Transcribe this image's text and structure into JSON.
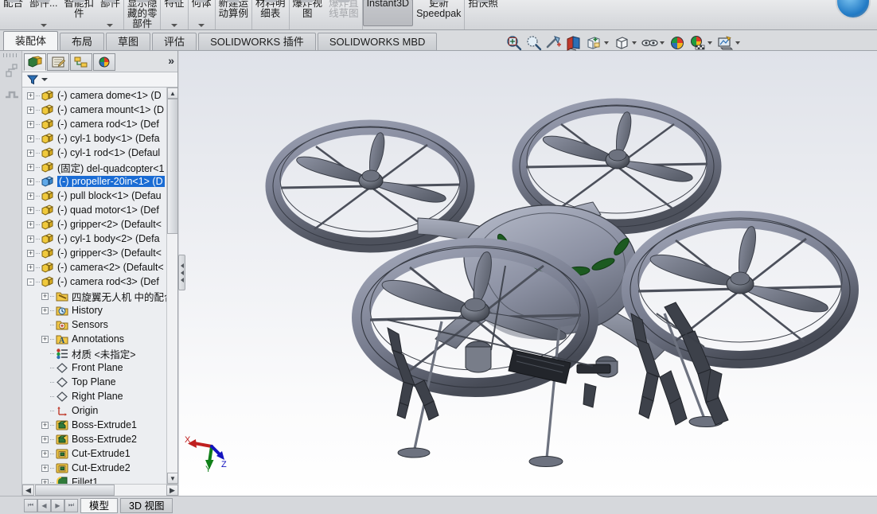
{
  "ribbon": {
    "buttons": [
      {
        "label": "配合",
        "carat": false,
        "dim": false,
        "pressed": false,
        "sep": false
      },
      {
        "label": "部件...",
        "carat": true,
        "dim": false,
        "pressed": false,
        "sep": false
      },
      {
        "label": "智能扣\n件",
        "carat": false,
        "dim": false,
        "pressed": false,
        "sep": false
      },
      {
        "label": "部件",
        "carat": true,
        "dim": false,
        "pressed": false,
        "sep": true
      },
      {
        "label": "显示隐\n藏的零\n部件",
        "carat": false,
        "dim": false,
        "pressed": false,
        "sep": true
      },
      {
        "label": "特征",
        "carat": true,
        "dim": false,
        "pressed": false,
        "sep": true
      },
      {
        "label": "何体",
        "carat": true,
        "dim": false,
        "pressed": false,
        "sep": true
      },
      {
        "label": "新建运\n动算例",
        "carat": false,
        "dim": false,
        "pressed": false,
        "sep": true
      },
      {
        "label": "材料明\n细表",
        "carat": false,
        "dim": false,
        "pressed": false,
        "sep": true
      },
      {
        "label": "爆炸视\n图",
        "carat": false,
        "dim": false,
        "pressed": false,
        "sep": false
      },
      {
        "label": "爆炸直\n线草图",
        "carat": false,
        "dim": true,
        "pressed": false,
        "sep": true
      },
      {
        "label": "Instant3D",
        "carat": false,
        "dim": false,
        "pressed": true,
        "sep": false
      },
      {
        "label": "更新\nSpeedpak",
        "carat": false,
        "dim": false,
        "pressed": false,
        "sep": true
      },
      {
        "label": "拍快照",
        "carat": false,
        "dim": false,
        "pressed": false,
        "sep": false
      }
    ]
  },
  "command_tabs": [
    {
      "label": "装配体",
      "active": true
    },
    {
      "label": "布局",
      "active": false
    },
    {
      "label": "草图",
      "active": false
    },
    {
      "label": "评估",
      "active": false
    },
    {
      "label": "SOLIDWORKS 插件",
      "active": false
    },
    {
      "label": "SOLIDWORKS MBD",
      "active": false
    }
  ],
  "view_toolbar": [
    {
      "icon": "zoom-to-fit-icon",
      "dropdown": false
    },
    {
      "icon": "zoom-to-area-icon",
      "dropdown": false
    },
    {
      "icon": "previous-view-icon",
      "dropdown": false
    },
    {
      "icon": "section-view-icon",
      "dropdown": false
    },
    {
      "icon": "view-orientation-icon",
      "dropdown": true
    },
    {
      "icon": "display-style-icon",
      "dropdown": true
    },
    {
      "icon": "hide-show-items-icon",
      "dropdown": true
    },
    {
      "icon": "edit-appearance-icon",
      "dropdown": false
    },
    {
      "icon": "apply-scene-icon",
      "dropdown": true
    },
    {
      "icon": "view-settings-icon",
      "dropdown": true
    }
  ],
  "feature_manager": {
    "tabs": [
      {
        "name": "featuremanager-design-tree-tab",
        "active": true
      },
      {
        "name": "property-manager-tab",
        "active": false
      },
      {
        "name": "configuration-manager-tab",
        "active": false
      },
      {
        "name": "display-manager-tab",
        "active": false
      }
    ],
    "expand_label": "»",
    "filter_placeholder": "",
    "tree": [
      {
        "label": "(-) camera dome<1> (D",
        "icon": "part-icon",
        "expander": "+",
        "indent": 0,
        "selected": false
      },
      {
        "label": "(-) camera mount<1> (D",
        "icon": "part-icon",
        "expander": "+",
        "indent": 0,
        "selected": false
      },
      {
        "label": "(-) camera rod<1> (Def",
        "icon": "part-icon",
        "expander": "+",
        "indent": 0,
        "selected": false
      },
      {
        "label": "(-) cyl-1 body<1> (Defa",
        "icon": "part-icon",
        "expander": "+",
        "indent": 0,
        "selected": false
      },
      {
        "label": "(-) cyl-1 rod<1> (Defaul",
        "icon": "part-icon",
        "expander": "+",
        "indent": 0,
        "selected": false
      },
      {
        "label": "(固定) del-quadcopter<1",
        "icon": "part-icon",
        "expander": "+",
        "indent": 0,
        "selected": false
      },
      {
        "label": "(-) propeller-20in<1> (D",
        "icon": "part-icon-blue",
        "expander": "+",
        "indent": 0,
        "selected": true
      },
      {
        "label": "(-) pull block<1> (Defau",
        "icon": "part-icon",
        "expander": "+",
        "indent": 0,
        "selected": false
      },
      {
        "label": "(-) quad motor<1> (Def",
        "icon": "part-icon",
        "expander": "+",
        "indent": 0,
        "selected": false
      },
      {
        "label": "(-) gripper<2> (Default<",
        "icon": "part-icon",
        "expander": "+",
        "indent": 0,
        "selected": false
      },
      {
        "label": "(-) cyl-1 body<2> (Defa",
        "icon": "part-icon",
        "expander": "+",
        "indent": 0,
        "selected": false
      },
      {
        "label": "(-) gripper<3> (Default<",
        "icon": "part-icon",
        "expander": "+",
        "indent": 0,
        "selected": false
      },
      {
        "label": "(-) camera<2> (Default<",
        "icon": "part-icon",
        "expander": "+",
        "indent": 0,
        "selected": false
      },
      {
        "label": "(-) camera rod<3> (Def",
        "icon": "part-icon",
        "expander": "-",
        "indent": 0,
        "selected": false
      },
      {
        "label": "四旋翼无人机 中的配合",
        "icon": "mates-folder-icon",
        "expander": "+",
        "indent": 1,
        "selected": false
      },
      {
        "label": "History",
        "icon": "history-icon",
        "expander": "+",
        "indent": 1,
        "selected": false
      },
      {
        "label": "Sensors",
        "icon": "sensors-icon",
        "expander": "",
        "indent": 1,
        "selected": false
      },
      {
        "label": "Annotations",
        "icon": "annotations-icon",
        "expander": "+",
        "indent": 1,
        "selected": false
      },
      {
        "label": "材质 <未指定>",
        "icon": "material-icon",
        "expander": "",
        "indent": 1,
        "selected": false
      },
      {
        "label": "Front Plane",
        "icon": "plane-icon",
        "expander": "",
        "indent": 1,
        "selected": false
      },
      {
        "label": "Top Plane",
        "icon": "plane-icon",
        "expander": "",
        "indent": 1,
        "selected": false
      },
      {
        "label": "Right Plane",
        "icon": "plane-icon",
        "expander": "",
        "indent": 1,
        "selected": false
      },
      {
        "label": "Origin",
        "icon": "origin-icon",
        "expander": "",
        "indent": 1,
        "selected": false
      },
      {
        "label": "Boss-Extrude1",
        "icon": "boss-extrude-icon",
        "expander": "+",
        "indent": 1,
        "selected": false
      },
      {
        "label": "Boss-Extrude2",
        "icon": "boss-extrude-icon",
        "expander": "+",
        "indent": 1,
        "selected": false
      },
      {
        "label": "Cut-Extrude1",
        "icon": "cut-extrude-icon",
        "expander": "+",
        "indent": 1,
        "selected": false
      },
      {
        "label": "Cut-Extrude2",
        "icon": "cut-extrude-icon",
        "expander": "+",
        "indent": 1,
        "selected": false
      },
      {
        "label": "Fillet1",
        "icon": "fillet-icon",
        "expander": "+",
        "indent": 1,
        "selected": false
      }
    ]
  },
  "bottom_bar": {
    "nav": [
      "first-record-icon",
      "previous-record-icon",
      "next-record-icon",
      "last-record-icon"
    ],
    "tabs": [
      {
        "label": "模型",
        "active": true
      },
      {
        "label": "3D 视图",
        "active": false
      }
    ]
  },
  "viewport": {
    "model_name": "quadcopter-assembly",
    "triad": {
      "x_label": "X",
      "y_label": "Y",
      "z_label": "Z"
    },
    "colors": {
      "body": "#8e93a6",
      "body_dark": "#50545f",
      "accent_green": "#1c5a20",
      "background_top": "#dfe2e9",
      "background_bottom": "#ffffff",
      "selection_blue": "#1a6cd4"
    }
  }
}
